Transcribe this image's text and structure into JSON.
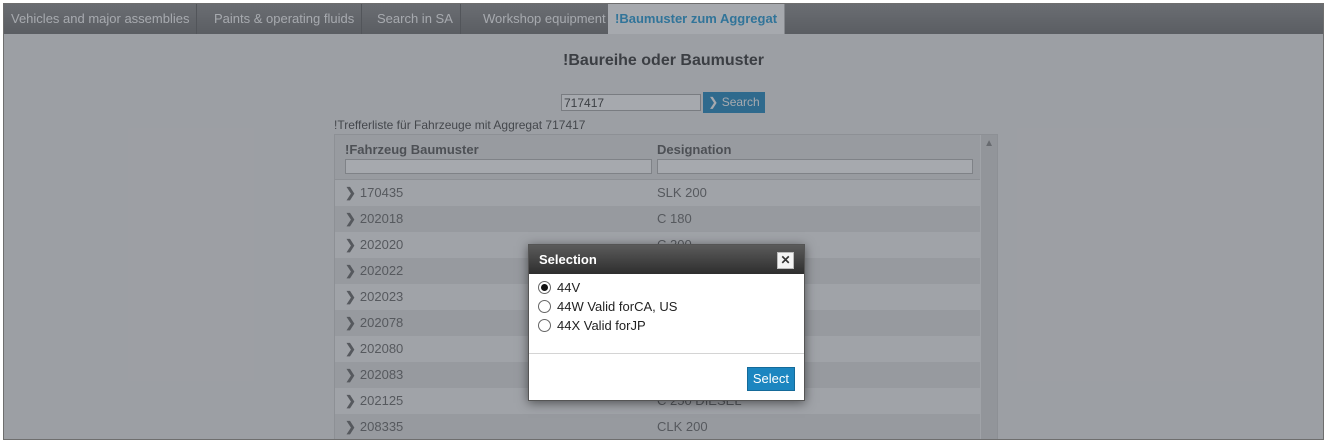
{
  "tabs": [
    {
      "label": "Vehicles and major assemblies"
    },
    {
      "label": "Paints & operating fluids"
    },
    {
      "label": "Search in SA"
    },
    {
      "label": "Workshop equipment"
    },
    {
      "label": "!Baumuster zum Aggregat",
      "active": true
    }
  ],
  "page": {
    "title": "!Baureihe oder Baumuster",
    "search_value": "717417",
    "search_button": "Search",
    "result_caption": "!Trefferliste für Fahrzeuge mit Aggregat 717417"
  },
  "grid": {
    "columns": [
      "!Fahrzeug Baumuster",
      "Designation"
    ],
    "rows": [
      {
        "model": "170435",
        "designation": "SLK 200"
      },
      {
        "model": "202018",
        "designation": "C 180"
      },
      {
        "model": "202020",
        "designation": "C 200"
      },
      {
        "model": "202022",
        "designation": ""
      },
      {
        "model": "202023",
        "designation": ""
      },
      {
        "model": "202078",
        "designation": ""
      },
      {
        "model": "202080",
        "designation": ""
      },
      {
        "model": "202083",
        "designation": ""
      },
      {
        "model": "202125",
        "designation": "C 250 DIESEL"
      },
      {
        "model": "208335",
        "designation": "CLK 200"
      }
    ]
  },
  "dialog": {
    "title": "Selection",
    "close_glyph": "✕",
    "options": [
      {
        "label": "44V",
        "selected": true
      },
      {
        "label": "44W Valid forCA, US",
        "selected": false
      },
      {
        "label": "44X Valid forJP",
        "selected": false
      }
    ],
    "select_button": "Select"
  },
  "colors": {
    "accent": "#1c86c0",
    "active_tab_text": "#1f9ad6"
  }
}
